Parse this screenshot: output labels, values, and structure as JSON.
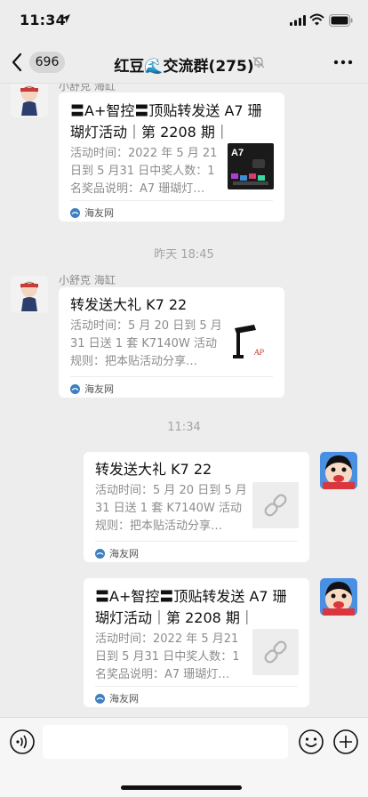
{
  "status_bar": {
    "time": "11:34",
    "icons": [
      "location-icon",
      "signal-icon",
      "wifi-icon",
      "battery-icon"
    ]
  },
  "nav": {
    "unread_count": "696",
    "title": "红豆🌊交流群(275)",
    "icons": [
      "back-arrow-icon",
      "mute-bell-icon",
      "more-dots-icon"
    ]
  },
  "messages": [
    {
      "sender": "小舒克 海缸",
      "title": "〓A+智控〓顶贴转发送 A7 珊瑚灯活动｜第 2208 期｜",
      "title_lines": [
        "〓A+智控〓顶贴转发送 A7 珊",
        "瑚灯活动｜第 2208 期｜"
      ],
      "desc_lines": [
        "活动时间：2022 年 5 月 21",
        "日到 5 月31 日中奖人数：1",
        "名奖品说明：A7 珊瑚灯…"
      ],
      "source": "海友网",
      "thumb": "a7-lamp-image"
    },
    {
      "sender": "小舒克 海缸",
      "title": "转发送大礼 K7 22",
      "desc_lines": [
        "活动时间：5 月 20 日到 5 月",
        "31 日送 1 套 K7140W 活动",
        "规则：把本贴活动分享…"
      ],
      "source": "海友网",
      "thumb": "k7-lamp-image"
    },
    {
      "title": "转发送大礼 K7 22",
      "desc_lines": [
        "活动时间：5 月 20 日到 5 月",
        "31 日送 1 套 K7140W 活动",
        "规则：把本贴活动分享…"
      ],
      "source": "海友网",
      "thumb": "link-icon"
    },
    {
      "title_lines": [
        "〓A+智控〓顶贴转发送 A7 珊",
        "瑚灯活动｜第 2208 期｜"
      ],
      "desc_lines": [
        "活动时间：2022 年 5 月21",
        "日到 5 月31 日中奖人数：1",
        "名奖品说明：A7 珊瑚灯…"
      ],
      "source": "海友网",
      "thumb": "link-icon"
    }
  ],
  "dividers": [
    "昨天 18:45",
    "11:34"
  ],
  "input_bar": {
    "placeholder": "",
    "icons": [
      "voice-icon",
      "emoji-icon",
      "plus-icon"
    ]
  },
  "colors": {
    "background": "#ededed",
    "card": "#ffffff",
    "subtle_text": "#8c8c8c"
  }
}
